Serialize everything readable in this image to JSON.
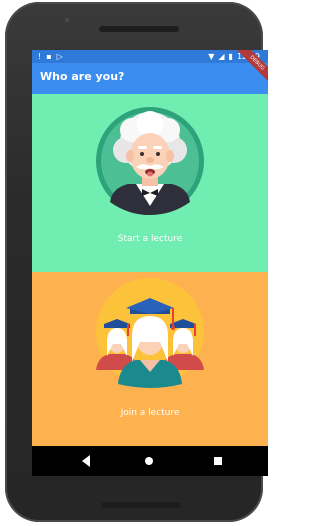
{
  "status_bar": {
    "time": "12:29",
    "left_icons": [
      "warning-icon",
      "sim-icon",
      "play-store-icon"
    ],
    "right_icons": [
      "wifi-icon",
      "signal-icon",
      "battery-icon"
    ]
  },
  "app_bar": {
    "title": "Who are you?"
  },
  "debug_banner": "DEBUG",
  "roles": [
    {
      "label": "Start a lecture",
      "background": "#70edb0",
      "avatar": "professor-avatar"
    },
    {
      "label": "Join a lecture",
      "background": "#feb24f",
      "avatar": "students-avatar"
    }
  ],
  "nav_bar": {
    "icons": [
      "back-icon",
      "home-icon",
      "recents-icon"
    ]
  }
}
